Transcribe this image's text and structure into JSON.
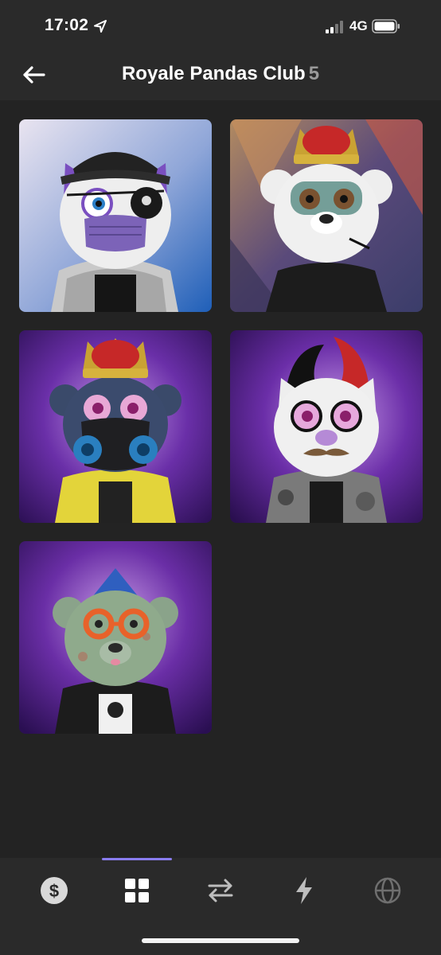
{
  "status_bar": {
    "time": "17:02",
    "network": "4G",
    "icons": [
      "location-arrow-icon",
      "signal-icon",
      "battery-icon"
    ]
  },
  "header": {
    "title": "Royale Pandas Club",
    "count": "5",
    "back_icon": "arrow-left-icon"
  },
  "grid": {
    "items": [
      {
        "name": "nft-1",
        "description_icon": "panda-nft-image"
      },
      {
        "name": "nft-2",
        "description_icon": "panda-nft-image"
      },
      {
        "name": "nft-3",
        "description_icon": "panda-nft-image"
      },
      {
        "name": "nft-4",
        "description_icon": "panda-nft-image"
      },
      {
        "name": "nft-5",
        "description_icon": "panda-nft-image"
      }
    ]
  },
  "tab_bar": {
    "tabs": [
      {
        "icon": "dollar-icon",
        "active": false
      },
      {
        "icon": "grid-icon",
        "active": true
      },
      {
        "icon": "swap-arrows-icon",
        "active": false
      },
      {
        "icon": "lightning-icon",
        "active": false
      },
      {
        "icon": "globe-icon",
        "active": false
      }
    ],
    "accent_color": "#8a7df0"
  },
  "colors": {
    "background": "#232323",
    "header_background": "#2a2a2a",
    "title_text": "#ffffff",
    "count_text": "#9a9a9a"
  }
}
